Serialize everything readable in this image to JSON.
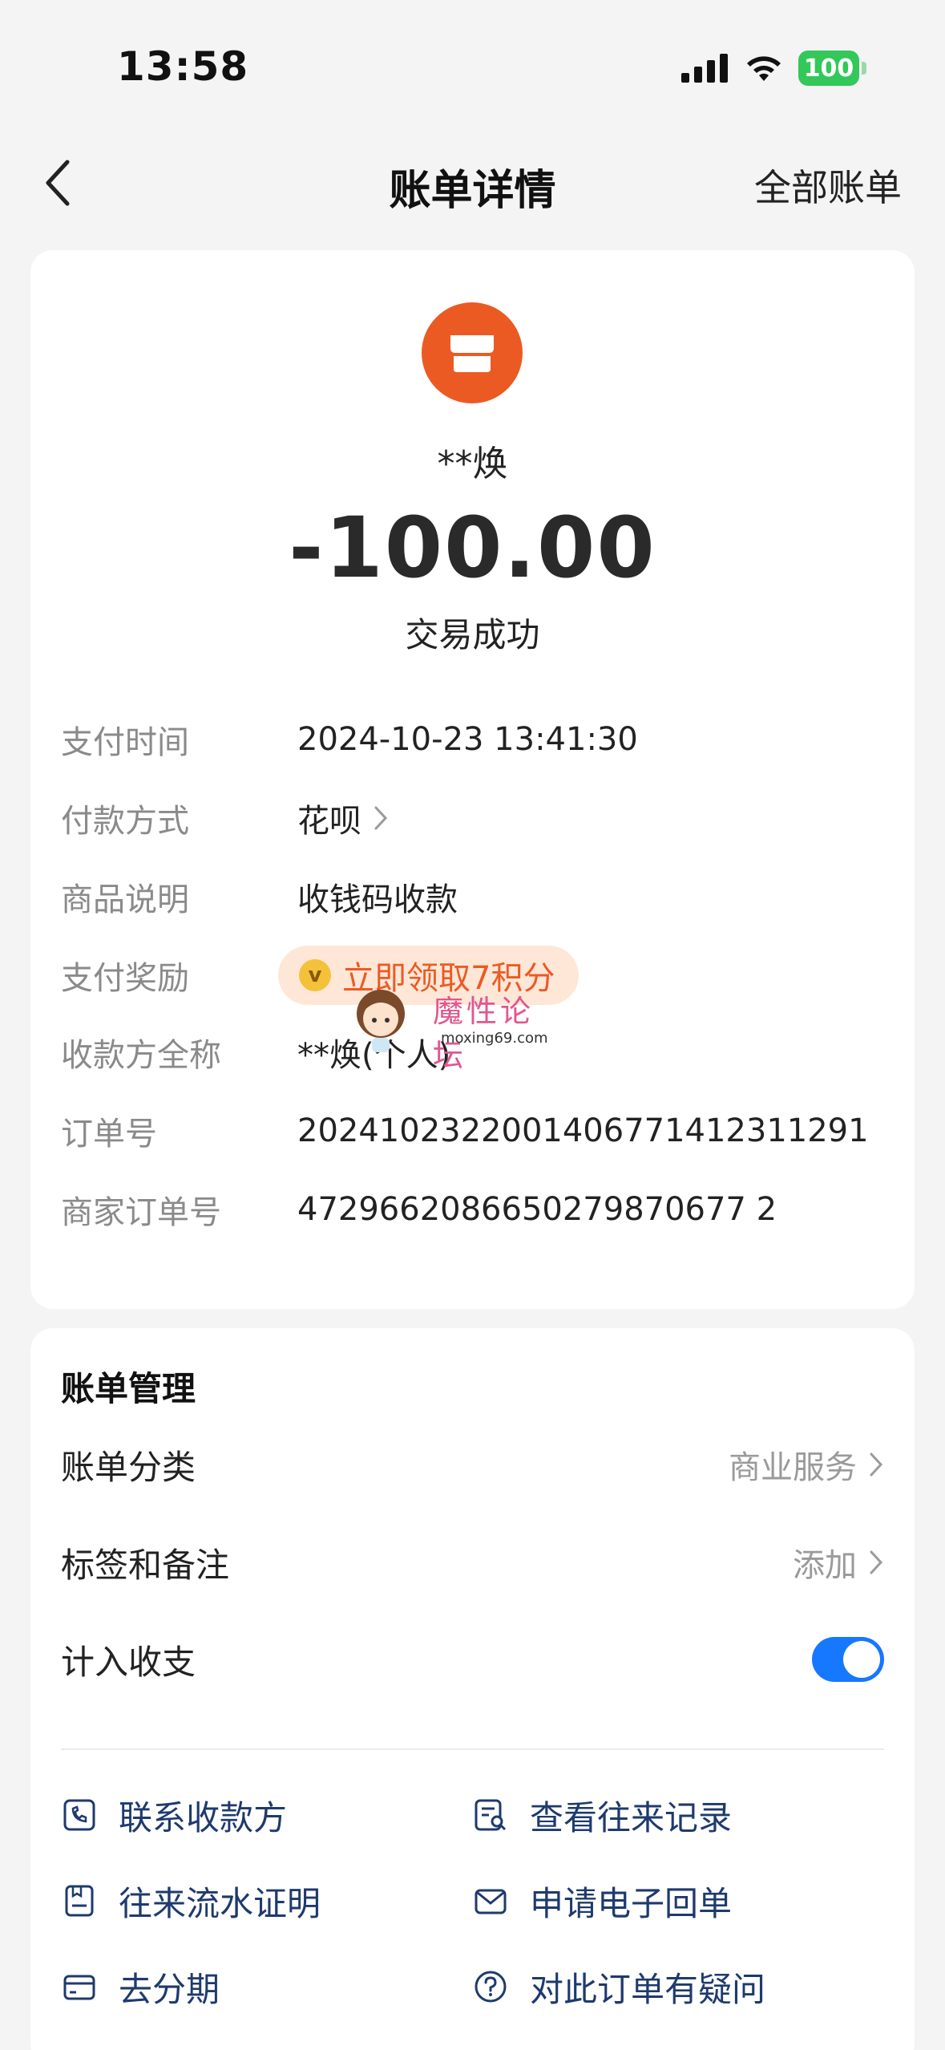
{
  "status_bar": {
    "time": "13:58",
    "battery": "100"
  },
  "nav": {
    "title": "账单详情",
    "right_label": "全部账单"
  },
  "summary": {
    "merchant_name": "**焕",
    "amount": "-100.00",
    "status": "交易成功"
  },
  "details": [
    {
      "label": "支付时间",
      "value": "2024-10-23 13:41:30"
    },
    {
      "label": "付款方式",
      "value": "花呗"
    },
    {
      "label": "商品说明",
      "value": "收钱码收款"
    },
    {
      "label": "支付奖励",
      "value": "立即领取7积分"
    },
    {
      "label": "收款方全称",
      "value": "**焕(个人)"
    },
    {
      "label": "订单号",
      "value": "2024102322001406771412311291"
    },
    {
      "label": "商家订单号",
      "value": "4729662086650279870677 2"
    }
  ],
  "watermark": {
    "text": "魔性论坛",
    "url": "moxing69.com"
  },
  "manage": {
    "title": "账单管理",
    "category_label": "账单分类",
    "category_value": "商业服务",
    "tags_label": "标签和备注",
    "tags_value": "添加",
    "include_label": "计入收支",
    "include_on": true
  },
  "actions": [
    {
      "label": "联系收款方",
      "icon": "phone-chat-icon"
    },
    {
      "label": "查看往来记录",
      "icon": "record-search-icon"
    },
    {
      "label": "往来流水证明",
      "icon": "statement-icon"
    },
    {
      "label": "申请电子回单",
      "icon": "envelope-icon"
    },
    {
      "label": "去分期",
      "icon": "card-icon"
    },
    {
      "label": "对此订单有疑问",
      "icon": "question-icon"
    }
  ],
  "colors": {
    "accent": "#1677ff",
    "merchant_icon": "#ec5a23",
    "reward": "#ec5a23",
    "action_text": "#1e3a6e"
  }
}
